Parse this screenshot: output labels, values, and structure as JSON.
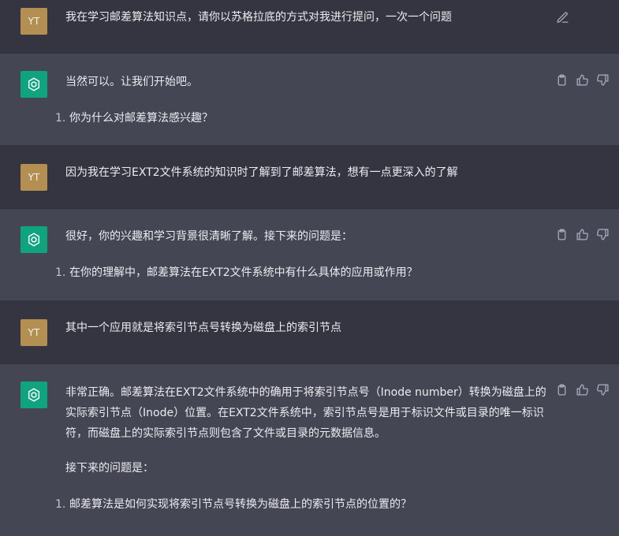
{
  "user_initials": "YT",
  "messages": [
    {
      "role": "user",
      "text": "我在学习邮差算法知识点，请你以苏格拉底的方式对我进行提问，一次一个问题"
    },
    {
      "role": "assistant",
      "paragraphs": [
        "当然可以。让我们开始吧。"
      ],
      "list": [
        {
          "num": "1.",
          "text": "你为什么对邮差算法感兴趣？"
        }
      ]
    },
    {
      "role": "user",
      "text": "因为我在学习EXT2文件系统的知识时了解到了邮差算法，想有一点更深入的了解"
    },
    {
      "role": "assistant",
      "paragraphs": [
        "很好，你的兴趣和学习背景很清晰了解。接下来的问题是："
      ],
      "list": [
        {
          "num": "1.",
          "text": "在你的理解中，邮差算法在EXT2文件系统中有什么具体的应用或作用？"
        }
      ]
    },
    {
      "role": "user",
      "text": "其中一个应用就是将索引节点号转换为磁盘上的索引节点"
    },
    {
      "role": "assistant",
      "paragraphs": [
        "非常正确。邮差算法在EXT2文件系统中的确用于将索引节点号（Inode number）转换为磁盘上的实际索引节点（Inode）位置。在EXT2文件系统中，索引节点号是用于标识文件或目录的唯一标识符，而磁盘上的实际索引节点则包含了文件或目录的元数据信息。",
        "接下来的问题是："
      ],
      "list": [
        {
          "num": "1.",
          "text": "邮差算法是如何实现将索引节点号转换为磁盘上的索引节点的位置的？"
        }
      ]
    }
  ],
  "colors": {
    "user_bg": "#343541",
    "assistant_bg": "#444654",
    "user_avatar": "#b39052",
    "assistant_avatar": "#10a37f"
  },
  "icons": {
    "assistant_actions": [
      "clipboard-icon",
      "thumbs-up-icon",
      "thumbs-down-icon"
    ],
    "user_action": "edit-icon",
    "assistant_avatar": "openai-logo-icon"
  }
}
